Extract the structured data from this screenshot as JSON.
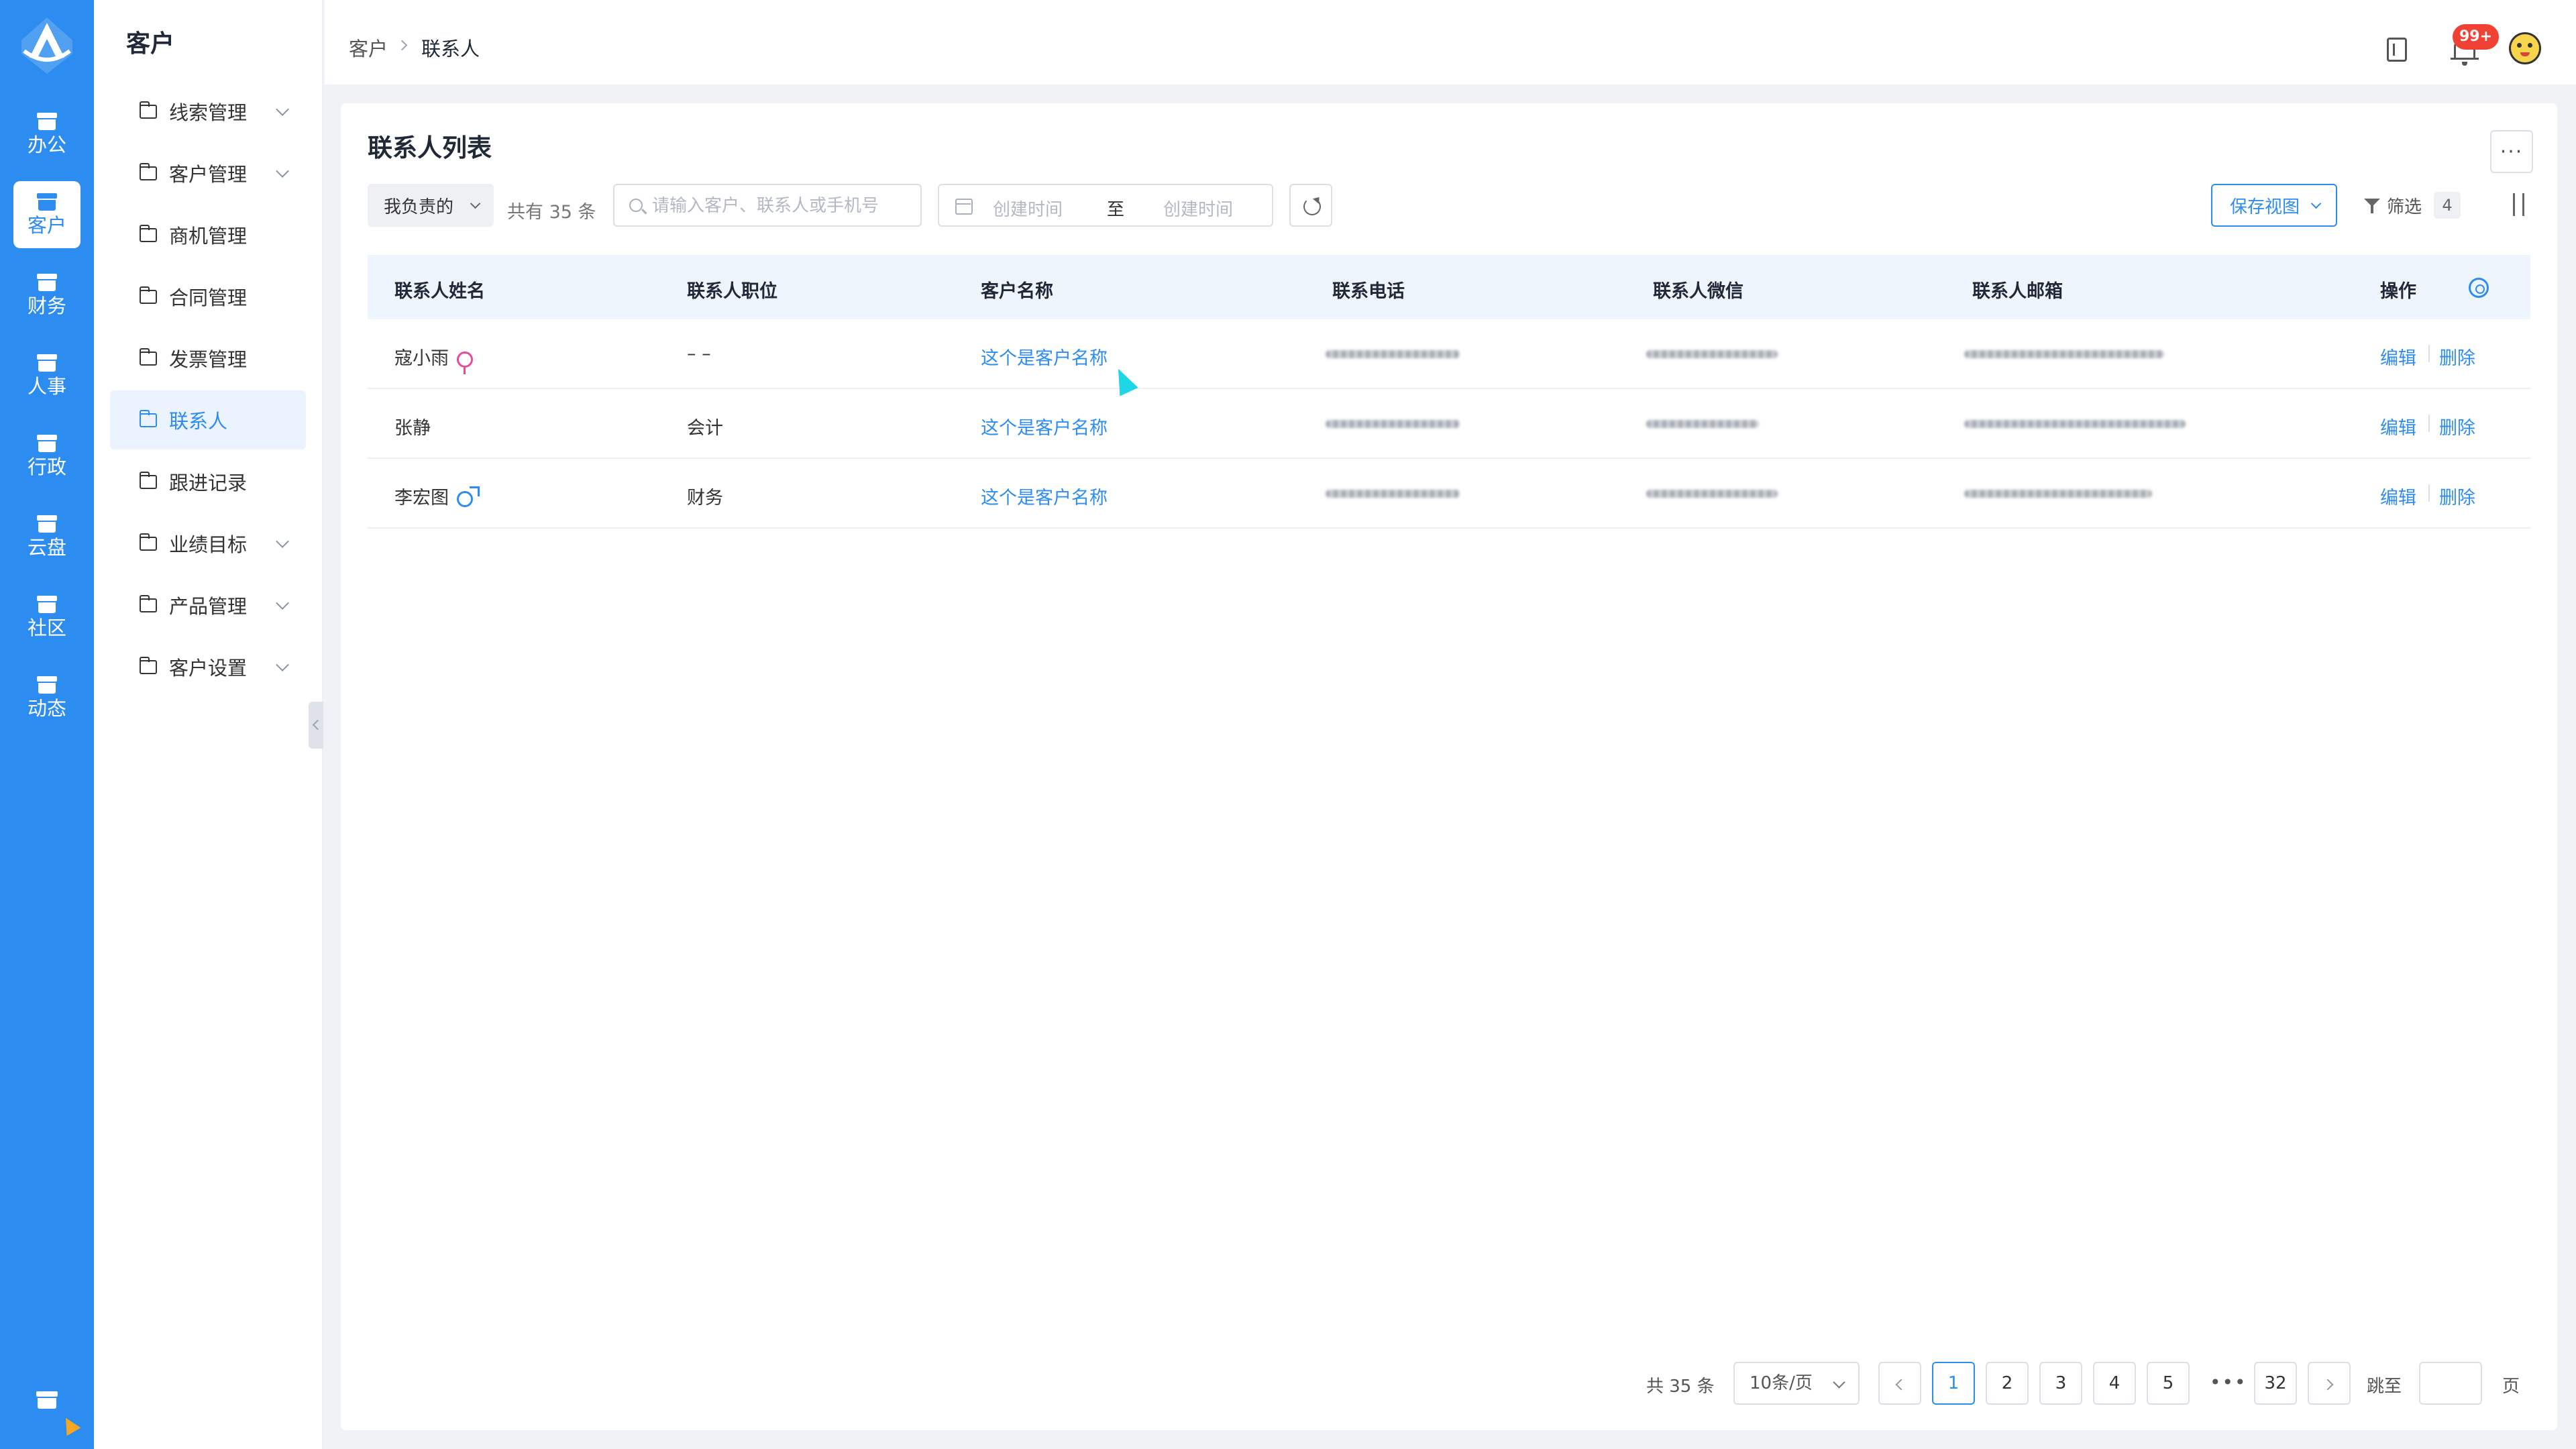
{
  "app": {
    "logo_icon": "app-logo-icon",
    "accent_color": "#2d8cf0"
  },
  "rail": {
    "items": [
      {
        "label": "办公",
        "icon": "office-icon"
      },
      {
        "label": "客户",
        "icon": "customer-icon",
        "active": true
      },
      {
        "label": "财务",
        "icon": "finance-icon"
      },
      {
        "label": "人事",
        "icon": "hr-icon"
      },
      {
        "label": "行政",
        "icon": "admin-icon"
      },
      {
        "label": "云盘",
        "icon": "cloud-drive-icon"
      },
      {
        "label": "社区",
        "icon": "community-icon"
      },
      {
        "label": "动态",
        "icon": "activity-icon"
      }
    ]
  },
  "sidebar": {
    "title": "客户",
    "items": [
      {
        "label": "线索管理",
        "expandable": true
      },
      {
        "label": "客户管理",
        "expandable": true
      },
      {
        "label": "商机管理",
        "expandable": false
      },
      {
        "label": "合同管理",
        "expandable": false
      },
      {
        "label": "发票管理",
        "expandable": false
      },
      {
        "label": "联系人",
        "expandable": false,
        "active": true
      },
      {
        "label": "跟进记录",
        "expandable": false
      },
      {
        "label": "业绩目标",
        "expandable": true
      },
      {
        "label": "产品管理",
        "expandable": true
      },
      {
        "label": "客户设置",
        "expandable": true
      }
    ]
  },
  "header": {
    "breadcrumb": [
      "客户",
      "联系人"
    ],
    "notification_badge": "99+"
  },
  "main": {
    "title": "联系人列表",
    "more_label": "···",
    "scope_filter": "我负责的",
    "total_text": "共有 35 条",
    "search_placeholder": "请输入客户、联系人或手机号",
    "date_start_placeholder": "创建时间",
    "date_separator": "至",
    "date_end_placeholder": "创建时间",
    "save_view_label": "保存视图",
    "filter_label": "筛选",
    "filter_count": "4"
  },
  "table": {
    "columns": [
      "联系人姓名",
      "联系人职位",
      "客户名称",
      "联系电话",
      "联系人微信",
      "联系人邮箱",
      "操作"
    ],
    "rows": [
      {
        "name": "寇小雨",
        "gender": "female",
        "position": "– –",
        "customer": "这个是客户名称",
        "edit": "编辑",
        "delete": "删除"
      },
      {
        "name": "张静",
        "gender": "",
        "position": "会计",
        "customer": "这个是客户名称",
        "edit": "编辑",
        "delete": "删除"
      },
      {
        "name": "李宏图",
        "gender": "male",
        "position": "财务",
        "customer": "这个是客户名称",
        "edit": "编辑",
        "delete": "删除"
      }
    ]
  },
  "pagination": {
    "total": "共 35 条",
    "page_size": "10条/页",
    "pages": [
      "1",
      "2",
      "3",
      "4",
      "5"
    ],
    "ellipsis": "•••",
    "last_page": "32",
    "current_page": "1",
    "jump_label": "跳至",
    "page_suffix": "页"
  }
}
